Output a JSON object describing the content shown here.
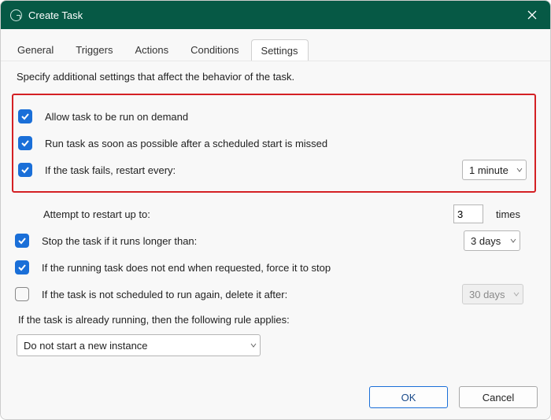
{
  "window": {
    "title": "Create Task"
  },
  "tabs": {
    "general": "General",
    "triggers": "Triggers",
    "actions": "Actions",
    "conditions": "Conditions",
    "settings": "Settings",
    "active": "settings"
  },
  "hint": "Specify additional settings that affect the behavior of the task.",
  "settings": {
    "allow_on_demand": {
      "checked": true,
      "label": "Allow task to be run on demand"
    },
    "run_asap": {
      "checked": true,
      "label": "Run task as soon as possible after a scheduled start is missed"
    },
    "restart_on_fail": {
      "checked": true,
      "label": "If the task fails, restart every:",
      "value": "1 minute"
    },
    "restart_attempts": {
      "label": "Attempt to restart up to:",
      "value": "3",
      "suffix": "times"
    },
    "stop_if_long": {
      "checked": true,
      "label": "Stop the task if it runs longer than:",
      "value": "3 days"
    },
    "force_stop": {
      "checked": true,
      "label": "If the running task does not end when requested, force it to stop"
    },
    "delete_after": {
      "checked": false,
      "label": "If the task is not scheduled to run again, delete it after:",
      "value": "30 days"
    },
    "rule_text": "If the task is already running, then the following rule applies:",
    "rule_value": "Do not start a new instance"
  },
  "buttons": {
    "ok": "OK",
    "cancel": "Cancel"
  }
}
